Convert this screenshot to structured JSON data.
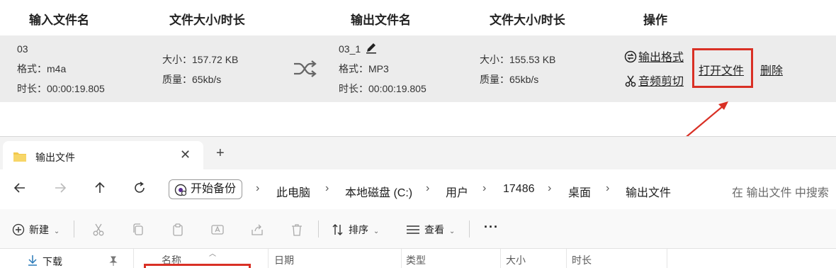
{
  "converter": {
    "headers": {
      "input_name": "输入文件名",
      "size_duration": "文件大小/时长",
      "output_name": "输出文件名",
      "out_size_duration": "文件大小/时长",
      "actions": "操作"
    },
    "row": {
      "input": {
        "name": "03",
        "format": "格式：m4a",
        "duration": "时长：00:00:19.805"
      },
      "input_info": {
        "size": "大小：157.72 KB",
        "quality": "质量：65kb/s"
      },
      "output": {
        "name": "03_1",
        "format": "格式：MP3",
        "duration": "时长：00:00:19.805"
      },
      "output_info": {
        "size": "大小：155.53 KB",
        "quality": "质量：65kb/s"
      },
      "actions": {
        "output_format": "输出格式",
        "audio_cut": "音频剪切",
        "open_file": "打开文件",
        "delete": "删除"
      }
    },
    "highlight_color": "#d93025"
  },
  "explorer": {
    "tab": {
      "title": "输出文件",
      "close": "✕",
      "new_tab": "+"
    },
    "nav": {
      "back": "back-icon",
      "forward": "forward-icon",
      "up": "up-icon",
      "refresh": "refresh-icon"
    },
    "address": {
      "backup_label": "开始备份",
      "crumbs": [
        "此电脑",
        "本地磁盘 (C:)",
        "用户",
        "17486",
        "桌面",
        "输出文件"
      ]
    },
    "search_placeholder": "在 输出文件 中搜索",
    "toolbar": {
      "new_label": "新建",
      "sort_label": "排序",
      "view_label": "查看",
      "more": "···"
    },
    "sidebar": {
      "downloads": "下载"
    },
    "columns": [
      "名称",
      "日期",
      "类型",
      "大小",
      "时长"
    ]
  }
}
